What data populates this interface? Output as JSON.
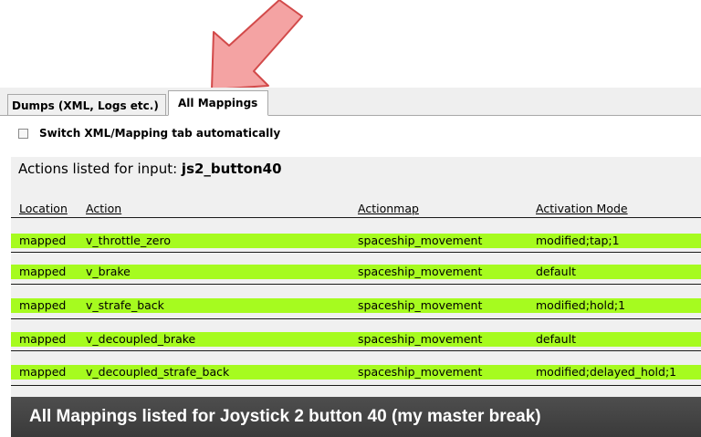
{
  "tabs": [
    {
      "label": "Dumps (XML, Logs etc.)",
      "active": false
    },
    {
      "label": "All Mappings",
      "active": true
    }
  ],
  "checkbox": {
    "label": "Switch XML/Mapping tab automatically",
    "checked": false
  },
  "panel": {
    "heading_prefix": "Actions listed for input: ",
    "heading_value": "js2_button40",
    "columns": [
      "Location",
      "Action",
      "Actionmap",
      "Activation Mode"
    ],
    "rows": [
      [
        "mapped",
        "v_throttle_zero",
        "spaceship_movement",
        "modified;tap;1"
      ],
      [
        "mapped",
        "v_brake",
        "spaceship_movement",
        "default"
      ],
      [
        "mapped",
        "v_strafe_back",
        "spaceship_movement",
        "modified;hold;1"
      ],
      [
        "mapped",
        "v_decoupled_brake",
        "spaceship_movement",
        "default"
      ],
      [
        "mapped",
        "v_decoupled_strafe_back",
        "spaceship_movement",
        "modified;delayed_hold;1"
      ]
    ],
    "row_color": "#a6fb1f"
  },
  "caption": "All Mappings listed for Joystick 2 button 40 (my master break)",
  "colors": {
    "arrow": "#f28b8b",
    "arrow_outline": "#d24a4a",
    "caption_bg": "#444444"
  }
}
